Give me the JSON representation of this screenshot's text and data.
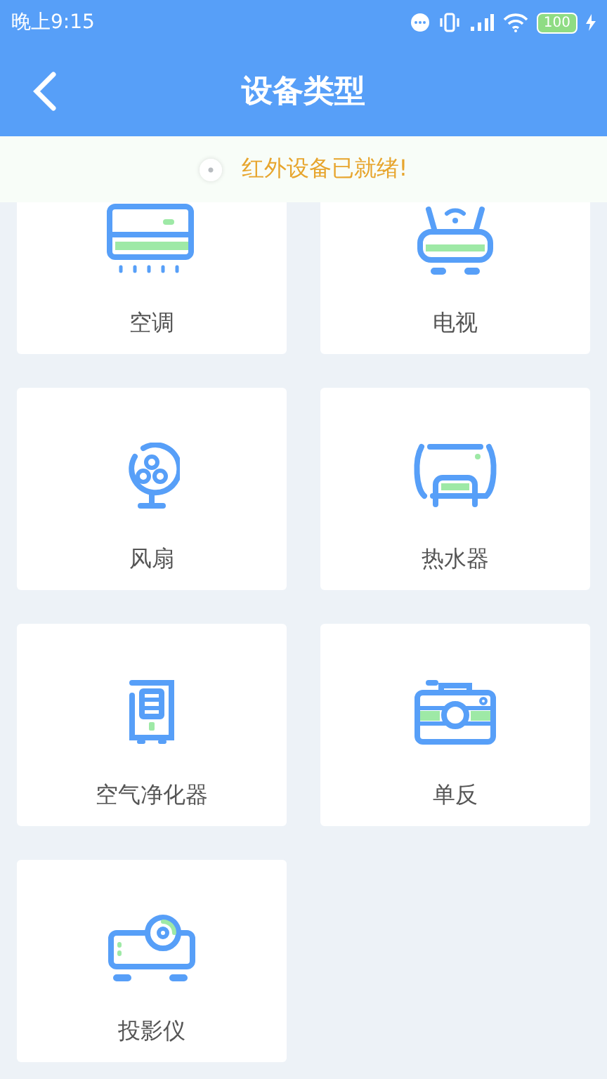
{
  "status_bar": {
    "time": "晚上9:15",
    "battery": "100"
  },
  "header": {
    "title": "设备类型"
  },
  "banner": {
    "message": "红外设备已就绪!"
  },
  "devices": [
    {
      "kind": "aircon",
      "label": "空调"
    },
    {
      "kind": "tv",
      "label": "电视"
    },
    {
      "kind": "fan",
      "label": "风扇"
    },
    {
      "kind": "heater",
      "label": "热水器"
    },
    {
      "kind": "purifier",
      "label": "空气净化器"
    },
    {
      "kind": "camera",
      "label": "单反"
    },
    {
      "kind": "projector",
      "label": "投影仪"
    }
  ]
}
